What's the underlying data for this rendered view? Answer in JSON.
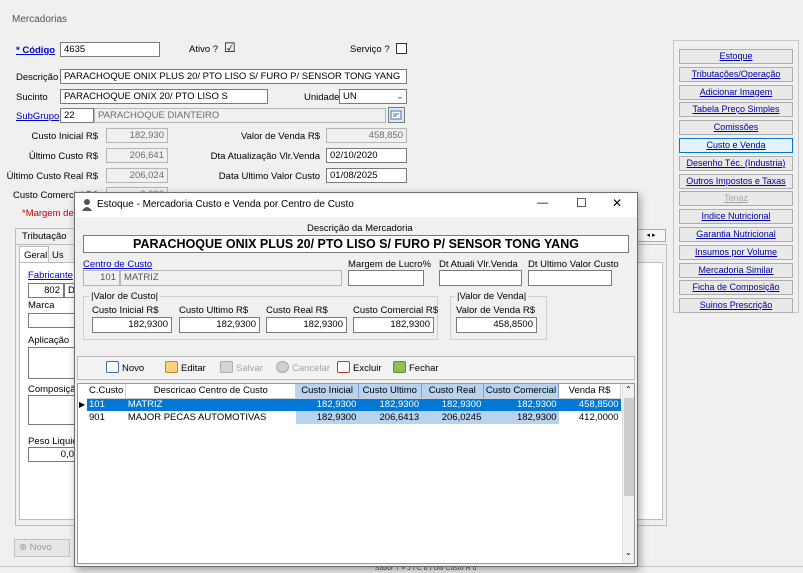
{
  "main": {
    "window_title": "Mercadorias",
    "codigo_label": "* Código",
    "codigo_value": "4635",
    "ativo_label": "Ativo ?",
    "ativo_checked": "☑",
    "servico_label": "Serviço ?",
    "descricao_label": "Descrição",
    "descricao_value": "PARACHOQUE ONIX PLUS 20/ PTO LISO S/ FURO P/ SENSOR TONG YANG",
    "sucinto_label": "Sucinto",
    "sucinto_value": "PARACHOQUE ONIX 20/ PTO LISO S",
    "unidade_label": "Unidade",
    "unidade_value": "UN",
    "subgrupo_label": "SubGrupo",
    "subgrupo_code": "22",
    "subgrupo_name": "PARACHOQUE DIANTEIRO",
    "custo_inicial_label": "Custo Inicial R$",
    "custo_inicial_value": "182,930",
    "ultimo_custo_label": "Último Custo R$",
    "ultimo_custo_value": "206,641",
    "ultimo_custo_real_label": "Último Custo Real R$",
    "ultimo_custo_real_value": "206,024",
    "custo_comercial_label": "Custo Comercial R$",
    "custo_comercial_value": "0,000",
    "valor_venda_label": "Valor de Venda R$",
    "valor_venda_value": "458,850",
    "dt_atualiza_label": "Dta Atualização Vlr.Venda",
    "dt_atualiza_value": "02/10/2020",
    "dt_ultimo_custo_label": "Data Ultimo Valor Custo",
    "dt_ultimo_custo_value": "01/08/2025",
    "margem_label": "*Margem de L",
    "tab_tributacao": "Tributação",
    "subtab_geral": "Geral",
    "subtab_us": "Us",
    "fabricante_label": "Fabricante",
    "fabricante_value": "802",
    "fabricante_value2": "D",
    "marca_label": "Marca",
    "aplicacao_label": "Aplicação",
    "composicao_label": "Composição",
    "peso_label": "Peso Liquid",
    "peso_value": "0,0",
    "novo_button": "Novo",
    "status_text": "* Sabor  T  ≡  J  t  C  b  t  Últi  Custo  R  d"
  },
  "right_buttons": [
    {
      "label": "Estoque",
      "state": "normal"
    },
    {
      "label": "Tributações/Operação",
      "state": "normal"
    },
    {
      "label": "Adicionar Imagem",
      "state": "normal"
    },
    {
      "label": "Tabela Preço Simples",
      "state": "normal"
    },
    {
      "label": "Comissões",
      "state": "normal"
    },
    {
      "label": "Custo e Venda",
      "state": "selected"
    },
    {
      "label": "Desenho Téc. (Industria)",
      "state": "normal"
    },
    {
      "label": "Outros Impostos e Taxas",
      "state": "normal"
    },
    {
      "label": "Tenaz",
      "state": "disabled"
    },
    {
      "label": "Indice Nutricional",
      "state": "normal"
    },
    {
      "label": "Garantia Nutricional",
      "state": "normal"
    },
    {
      "label": "Insumos por Volume",
      "state": "normal"
    },
    {
      "label": "Mercadoria Similar",
      "state": "normal"
    },
    {
      "label": "Ficha de Composição",
      "state": "normal"
    },
    {
      "label": "Suinos Prescrição",
      "state": "normal"
    }
  ],
  "dialog": {
    "title": "Estoque - Mercadoria Custo e Venda por Centro de Custo",
    "minimize": "—",
    "maximize": "☐",
    "close": "✕",
    "desc_label": "Descrição da Mercadoria",
    "desc_value": "PARACHOQUE ONIX PLUS 20/ PTO LISO S/ FURO P/ SENSOR TONG YANG",
    "centro_label": "Centro de Custo",
    "centro_code": "101",
    "centro_name": "MATRIZ",
    "margem_label": "Margem de Lucro%",
    "dt_atual_label": "Dt Atuali Vlr.Venda",
    "dt_ultimo_label": "Dt Ultimo Valor Custo",
    "grp_custo": "Valor de Custo",
    "grp_venda": "Valor de Venda",
    "custo_inicial_label": "Custo Inicial R$",
    "custo_inicial_value": "182,9300",
    "custo_ultimo_label": "Custo Ultimo R$",
    "custo_ultimo_value": "182,9300",
    "custo_real_label": "Custo Real R$",
    "custo_real_value": "182,9300",
    "custo_comercial_label": "Custo Comercial R$",
    "custo_comercial_value": "182,9300",
    "valor_venda_label": "Valor de Venda R$",
    "valor_venda_value": "458,8500",
    "toolbar": {
      "novo": "Novo",
      "editar": "Editar",
      "salvar": "Salvar",
      "cancelar": "Cancelar",
      "excluir": "Excluir",
      "fechar": "Fechar"
    },
    "grid": {
      "headers": [
        "C.Custo",
        "Descricao Centro de Custo",
        "Custo Inicial",
        "Custo Ultimo",
        "Custo Real",
        "Custo Comercial",
        "Venda R$"
      ],
      "rows": [
        [
          "101",
          "MATRIZ",
          "182,9300",
          "182,9300",
          "182,9300",
          "182,9300",
          "458,8500"
        ],
        [
          "901",
          "MAJOR PECAS AUTOMOTIVAS",
          "182,9300",
          "206,6413",
          "206,0245",
          "182,9300",
          "412,0000"
        ]
      ]
    }
  }
}
